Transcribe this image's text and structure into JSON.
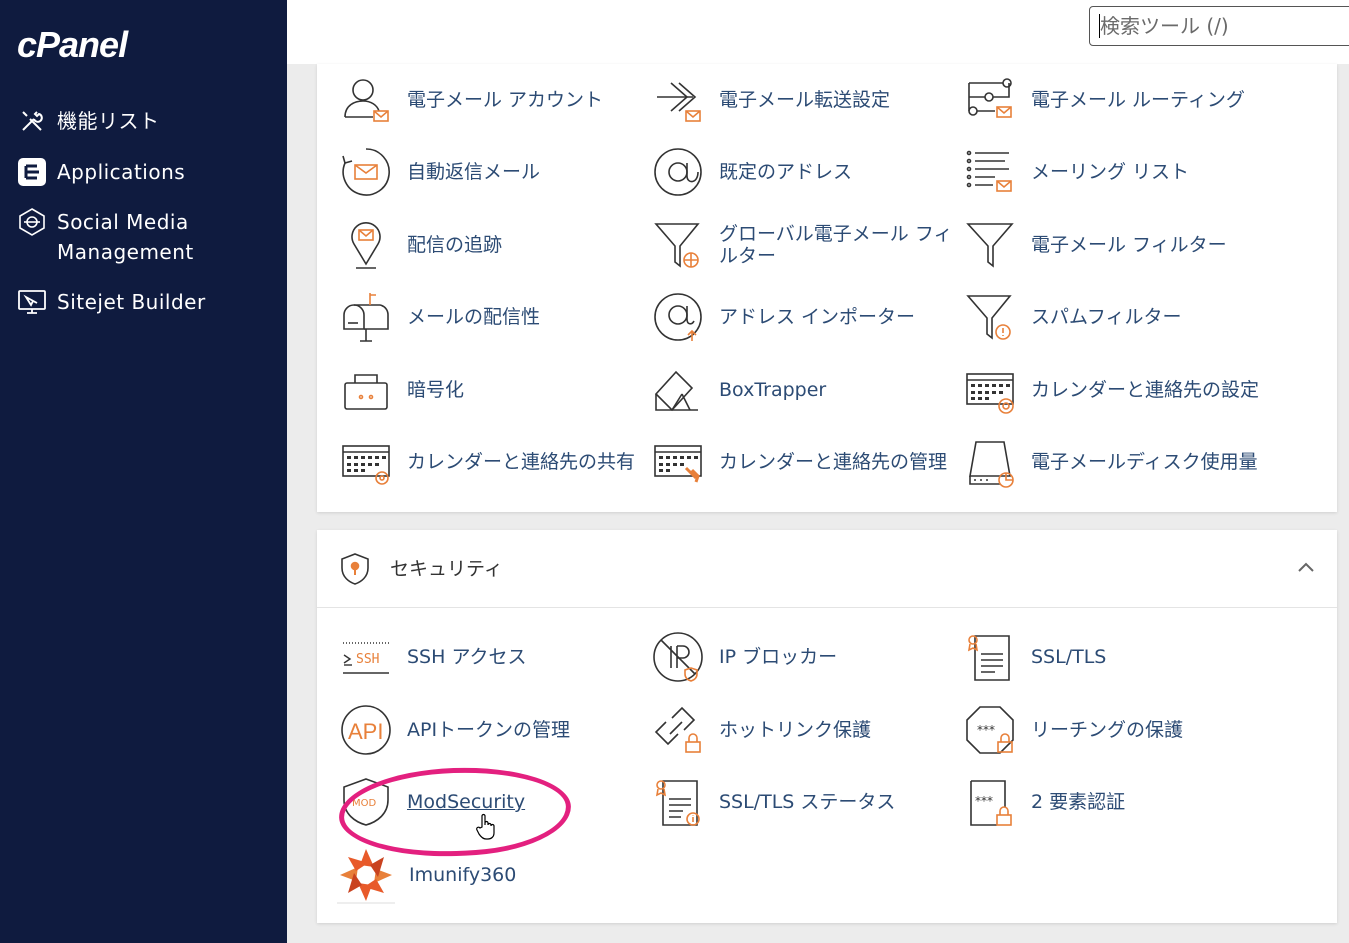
{
  "sidebar": {
    "logo": "cPanel",
    "items": [
      {
        "label": "機能リスト",
        "icon": "tools-icon"
      },
      {
        "label": "Applications",
        "icon": "applications-icon"
      },
      {
        "label": "Social Media Management",
        "icon": "social-media-icon"
      },
      {
        "label": "Sitejet Builder",
        "icon": "sitejet-icon"
      }
    ]
  },
  "search": {
    "placeholder": "検索ツール (/)"
  },
  "email": {
    "tools": [
      {
        "label": "電子メール アカウント",
        "icon": "email-account-icon"
      },
      {
        "label": "電子メール転送設定",
        "icon": "forwarders-icon"
      },
      {
        "label": "電子メール ルーティング",
        "icon": "routing-icon"
      },
      {
        "label": "自動返信メール",
        "icon": "autoresponder-icon"
      },
      {
        "label": "既定のアドレス",
        "icon": "at-icon"
      },
      {
        "label": "メーリング リスト",
        "icon": "mailing-list-icon"
      },
      {
        "label": "配信の追跡",
        "icon": "track-delivery-icon"
      },
      {
        "label": "グローバル電子メール フィルター",
        "icon": "global-filter-icon"
      },
      {
        "label": "電子メール フィルター",
        "icon": "filter-icon"
      },
      {
        "label": "メールの配信性",
        "icon": "mailbox-icon"
      },
      {
        "label": "アドレス インポーター",
        "icon": "address-importer-icon"
      },
      {
        "label": "スパムフィルター",
        "icon": "spam-filter-icon"
      },
      {
        "label": "暗号化",
        "icon": "encryption-icon"
      },
      {
        "label": "BoxTrapper",
        "icon": "boxtrapper-icon"
      },
      {
        "label": "カレンダーと連絡先の設定",
        "icon": "calendar-config-icon"
      },
      {
        "label": "カレンダーと連絡先の共有",
        "icon": "calendar-share-icon"
      },
      {
        "label": "カレンダーと連絡先の管理",
        "icon": "calendar-manage-icon"
      },
      {
        "label": "電子メールディスク使用量",
        "icon": "disk-usage-icon"
      }
    ]
  },
  "security": {
    "title": "セキュリティ",
    "tools": [
      {
        "label": "SSH アクセス",
        "icon": "ssh-icon"
      },
      {
        "label": "IP ブロッカー",
        "icon": "ip-blocker-icon"
      },
      {
        "label": "SSL/TLS",
        "icon": "ssl-icon"
      },
      {
        "label": "APIトークンの管理",
        "icon": "api-icon"
      },
      {
        "label": "ホットリンク保護",
        "icon": "hotlink-icon"
      },
      {
        "label": "リーチングの保護",
        "icon": "leech-icon"
      },
      {
        "label": "ModSecurity",
        "icon": "modsecurity-icon"
      },
      {
        "label": "SSL/TLS ステータス",
        "icon": "ssl-status-icon"
      },
      {
        "label": "2 要素認証",
        "icon": "two-factor-icon"
      },
      {
        "label": "Imunify360",
        "icon": "imunify-icon"
      }
    ]
  },
  "colors": {
    "sidebar": "#0f1b3f",
    "accent": "#e8803a",
    "link": "#2c4b74",
    "highlight": "#e3207f"
  }
}
